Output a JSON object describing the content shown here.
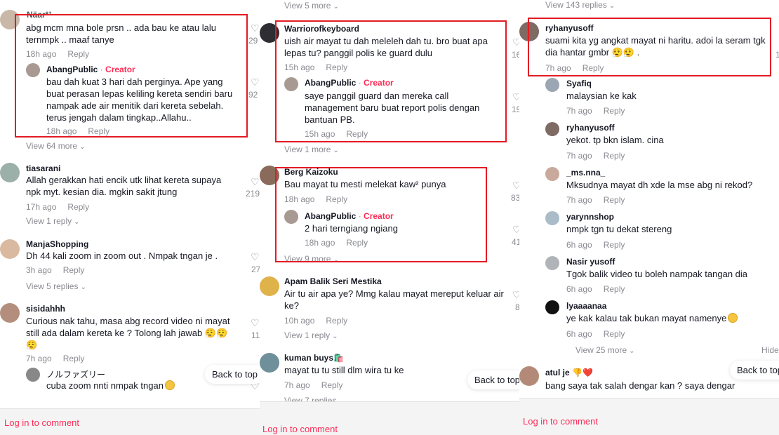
{
  "reply_label": "Reply",
  "creator_label": "Creator",
  "back_to_top": "Back to top",
  "login": "Log in to comment",
  "p1": {
    "c1": {
      "user": "Näar*³",
      "text": "abg mcm mna bole prsn .. ada bau ke atau lalu ternmpk .. maaf tanye",
      "time": "18h ago",
      "likes": "29"
    },
    "c1r": {
      "user": "AbangPublic",
      "text": "bau dah kuat 3 hari dah perginya. Ape yang buat perasan lepas keliling kereta sendiri baru nampak ade air menitik dari kereta sebelah. terus jengah dalam tingkap..Allahu..",
      "time": "18h ago",
      "likes": "92"
    },
    "more1": "View 64 more",
    "c2": {
      "user": "tiasarani",
      "text": "Allah gerakkan hati encik utk lihat kereta supaya npk myt. kesian dia. mgkin sakit jtung",
      "time": "17h ago",
      "likes": "219"
    },
    "more2": "View 1 reply",
    "c3": {
      "user": "ManjaShopping",
      "text": "Dh 44 kali zoom in zoom out . Nmpak tngan je .",
      "time": "3h ago",
      "likes": "27"
    },
    "more3": "View 5 replies",
    "c4": {
      "user": "sisidahhh",
      "text": "Curious nak tahu, masa abg record video ni mayat still ada dalam kereta ke ? Tolong lah jawab 😮‍💨😮‍💨😮‍💨",
      "time": "7h ago",
      "likes": "11"
    },
    "c5": {
      "user": "ノルファズリー",
      "text": "cuba zoom nnti nmpak tngan"
    }
  },
  "p2": {
    "top_more": "View 5 more",
    "c1": {
      "user": "Warriorofkeyboard",
      "text": "uish air mayat tu dah meleleh dah tu. bro buat apa lepas tu? panggil polis ke guard dulu",
      "time": "15h ago",
      "likes": "16"
    },
    "c1r": {
      "user": "AbangPublic",
      "text": "saye panggil guard dan mereka call management baru buat report polis dengan bantuan PB.",
      "time": "15h ago",
      "likes": "19"
    },
    "more1": "View 1 more",
    "c2": {
      "user": "Berg Kaizoku",
      "text": "Bau mayat tu mesti melekat kaw² punya",
      "time": "18h ago",
      "likes": "83"
    },
    "c2r": {
      "user": "AbangPublic",
      "text": "2 hari terngiang ngiang",
      "time": "18h ago",
      "likes": "41"
    },
    "more2": "View 9 more",
    "c3": {
      "user": "Apam Balik Seri Mestika",
      "text": "Air tu air apa ye? Mmg kalau mayat mereput keluar air ke?",
      "time": "10h ago",
      "likes": "8"
    },
    "more3": "View 1 reply",
    "c4": {
      "user": "kuman buys🛍️",
      "text": "mayat tu tu still dlm wira tu ke",
      "time": "7h ago"
    },
    "more4": "View 7 replies"
  },
  "p3": {
    "top_more": "View 143 replies",
    "c1": {
      "user": "ryhanyusoff",
      "text": "suami kita yg angkat mayat ni haritu. adoi la seram tgk dia hantar gmbr 😮‍💨😮‍💨 .",
      "time": "7h ago",
      "likes": "1"
    },
    "r1": {
      "user": "Syafiq",
      "text": "malaysian ke kak",
      "time": "7h ago"
    },
    "r2": {
      "user": "ryhanyusoff",
      "text": "yekot. tp bkn islam. cina",
      "time": "7h ago"
    },
    "r3": {
      "user": "_ms.nna_",
      "text": "Mksudnya mayat dh xde la mse abg ni rekod?",
      "time": "7h ago"
    },
    "r4": {
      "user": "yarynnshop",
      "text": "nmpk tgn tu dekat stereng",
      "time": "6h ago"
    },
    "r5": {
      "user": "Nasir yusoff",
      "text": "Tgok balik video tu boleh nampak tangan dia",
      "time": "6h ago"
    },
    "r6": {
      "user": "lyaaaanaa",
      "text": "ye kak kalau tak bukan mayat namenye",
      "time": "6h ago"
    },
    "more1": "View 25 more",
    "hide": "Hide",
    "c2": {
      "user": "atul je 👎❤️",
      "text": "bang saya tak salah dengar kan ? saya dengar"
    }
  }
}
